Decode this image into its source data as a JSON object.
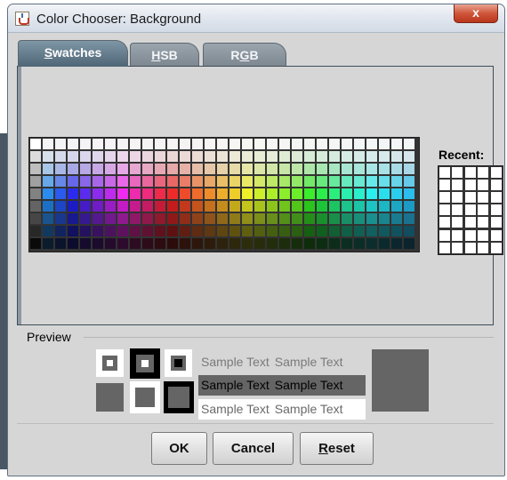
{
  "window": {
    "title": "Color Chooser: Background",
    "close_label": "x"
  },
  "tabs": [
    {
      "first": "S",
      "rest": "watches",
      "active": true
    },
    {
      "first": "H",
      "rest": "SB",
      "active": false
    },
    {
      "first": "R",
      "mid": "G",
      "rest": "B",
      "active": false
    }
  ],
  "swatches": {
    "recent_label": "Recent:",
    "recent_color": "#ffffff"
  },
  "preview": {
    "label": "Preview",
    "sample_text": "Sample Text",
    "color": "#656565"
  },
  "buttons": {
    "ok": "OK",
    "cancel": "Cancel",
    "reset_first": "R",
    "reset_rest": "eset"
  }
}
